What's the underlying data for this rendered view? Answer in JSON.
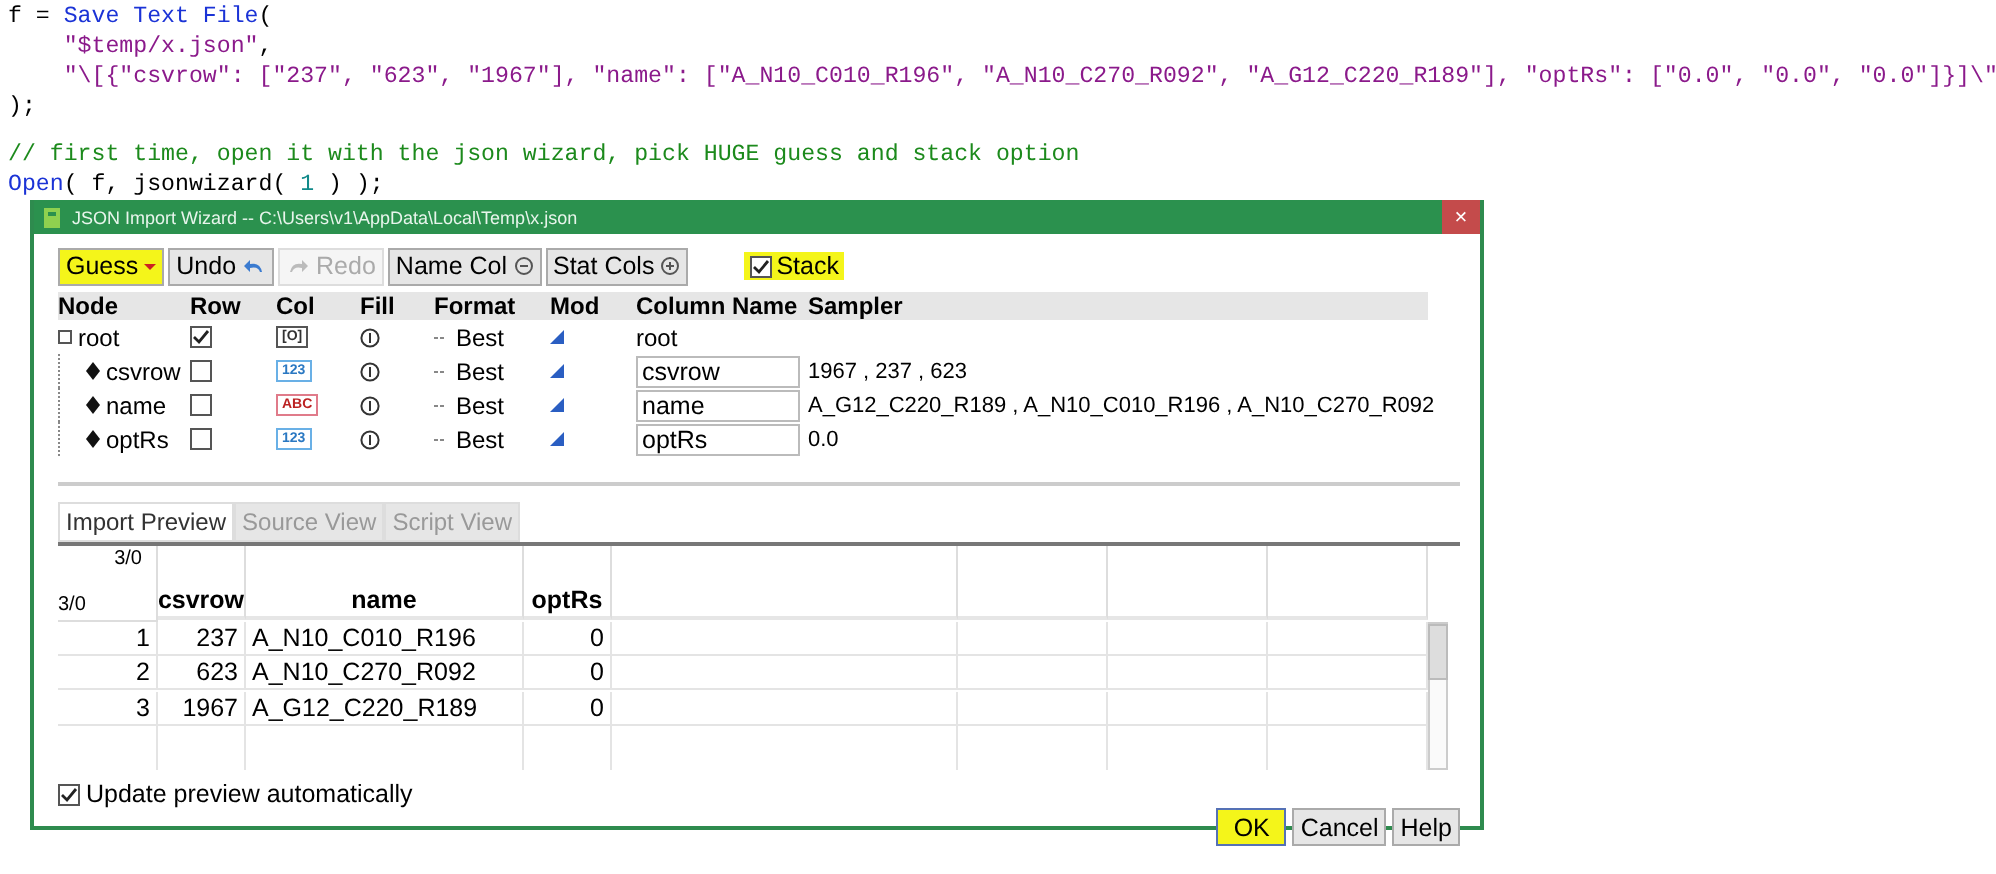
{
  "code_lines": [
    {
      "kind": "code",
      "tokens": [
        {
          "kind": "plain",
          "text": "f = "
        },
        {
          "kind": "keyword",
          "text": "Save Text File"
        },
        {
          "kind": "plain",
          "text": "("
        }
      ]
    },
    {
      "kind": "indented",
      "tokens": [
        {
          "kind": "string",
          "text": "\"$temp/x.json\""
        },
        {
          "kind": "plain",
          "text": ","
        }
      ]
    },
    {
      "kind": "indented",
      "tokens": [
        {
          "kind": "string",
          "text": "\"\\[{\"csvrow\": [\"237\", \"623\", \"1967\"], \"name\": [\"A_N10_C010_R196\", \"A_N10_C270_R092\", \"A_G12_C220_R189\"], \"optRs\": [\"0.0\", \"0.0\", \"0.0\"]}]\\\""
        }
      ]
    },
    {
      "kind": "code",
      "tokens": [
        {
          "kind": "plain",
          "text": ");"
        }
      ]
    },
    {
      "kind": "blank"
    },
    {
      "kind": "code",
      "tokens": [
        {
          "kind": "comment",
          "text": "// first time, open it with the json wizard, pick HUGE guess and stack option"
        }
      ]
    },
    {
      "kind": "code",
      "tokens": [
        {
          "kind": "keyword",
          "text": "Open"
        },
        {
          "kind": "plain",
          "text": "( f, jsonwizard( "
        },
        {
          "kind": "number",
          "text": "1"
        },
        {
          "kind": "plain",
          "text": " ) );"
        }
      ]
    }
  ],
  "dialog": {
    "title": "JSON Import Wizard -- C:\\Users\\v1\\AppData\\Local\\Temp\\x.json",
    "close": "×",
    "toolbar": [
      {
        "label": "Guess",
        "kind": "menu",
        "disabled": false,
        "highlighted": true
      },
      {
        "label": "Undo",
        "kind": "undo",
        "disabled": false,
        "highlighted": false
      },
      {
        "label": "Redo",
        "kind": "redo",
        "disabled": true,
        "highlighted": false
      },
      {
        "label": "Name Col",
        "kind": "minus",
        "disabled": false,
        "highlighted": false
      },
      {
        "label": "Stat Cols",
        "kind": "plus",
        "disabled": false,
        "highlighted": false
      }
    ],
    "stack": {
      "label": "Stack",
      "checked": true,
      "highlighted": true
    },
    "tree_columns": [
      "Node",
      "Row",
      "Col",
      "Fill",
      "Format",
      "Mod",
      "Column Name",
      "Sampler"
    ],
    "tree": [
      {
        "node": "root",
        "row_checked": true,
        "kind": "container",
        "col_icon": "[O]",
        "format": "Best",
        "column_name": "root",
        "children": [
          {
            "node": "csvrow",
            "row_checked": false,
            "kind": "numeric",
            "col_icon": "123",
            "format": "Best",
            "column_name": "csvrow",
            "sampler": "1967 , 237 , 623"
          },
          {
            "node": "name",
            "row_checked": false,
            "kind": "character",
            "col_icon": "ABC",
            "format": "Best",
            "column_name": "name",
            "sampler": "A_G12_C220_R189 , A_N10_C010_R196 , A_N10_C270_R092"
          },
          {
            "node": "optRs",
            "row_checked": false,
            "kind": "numeric",
            "col_icon": "123",
            "format": "Best",
            "column_name": "optRs",
            "sampler": "0.0"
          }
        ]
      }
    ],
    "tabs": [
      {
        "label": "Import Preview",
        "selected": true
      },
      {
        "label": "Source View",
        "selected": false
      },
      {
        "label": "Script View",
        "selected": false
      }
    ],
    "preview": {
      "corner_columns": "3/0",
      "corner_rows": "3/0",
      "columns": [
        "",
        "csvrow",
        "name",
        "optRs"
      ],
      "rows": [
        [
          "1",
          "237",
          "A_N10_C010_R196",
          "0"
        ],
        [
          "2",
          "623",
          "A_N10_C270_R092",
          "0"
        ],
        [
          "3",
          "1967",
          "A_G12_C220_R189",
          "0"
        ]
      ]
    },
    "update_preview": {
      "label": "Update preview automatically",
      "checked": true
    },
    "buttons": [
      {
        "label": "OK",
        "default": true,
        "highlighted": true
      },
      {
        "label": "Cancel",
        "default": false,
        "highlighted": false
      },
      {
        "label": "Help",
        "default": false,
        "highlighted": false
      }
    ]
  }
}
